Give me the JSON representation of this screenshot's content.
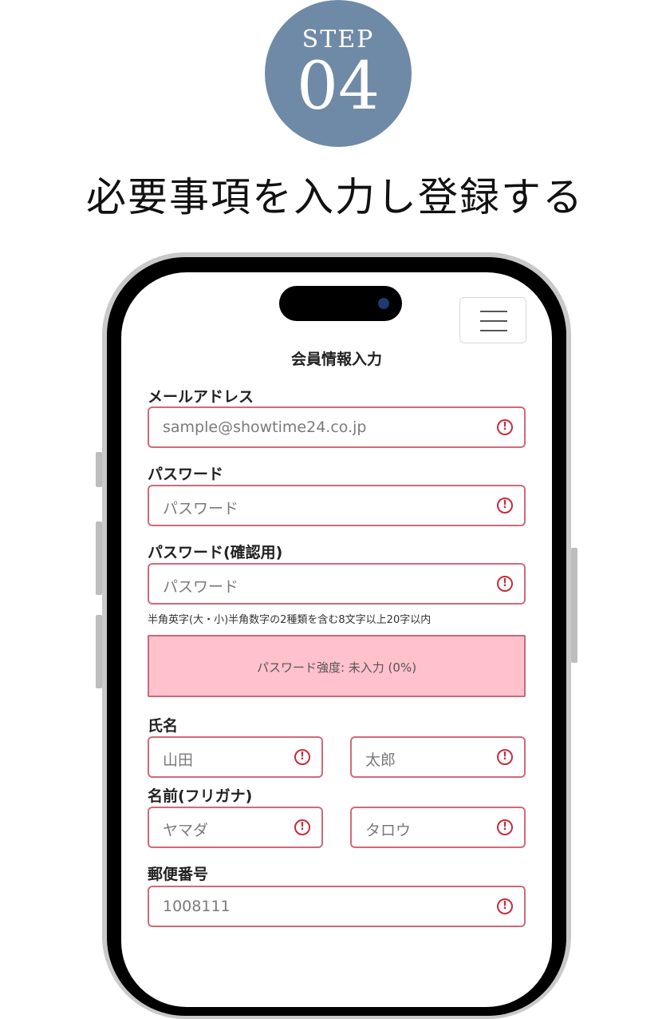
{
  "step": {
    "label": "STEP",
    "number": "04"
  },
  "headline": "必要事項を入力し登録する",
  "form": {
    "title": "会員情報入力",
    "email": {
      "label": "メールアドレス",
      "placeholder": "sample@showtime24.co.jp"
    },
    "password": {
      "label": "パスワード",
      "placeholder": "パスワード"
    },
    "password_confirm": {
      "label": "パスワード(確認用)",
      "placeholder": "パスワード"
    },
    "password_hint": "半角英字(大・小)半角数字の2種類を含む8文字以上20字以内",
    "strength": "パスワード強度: 未入力 (0%)",
    "name": {
      "label": "氏名",
      "last_placeholder": "山田",
      "first_placeholder": "太郎"
    },
    "kana": {
      "label": "名前(フリガナ)",
      "last_placeholder": "ヤマダ",
      "first_placeholder": "タロウ"
    },
    "postal": {
      "label": "郵便番号",
      "placeholder": "1008111"
    },
    "error_icon": "!"
  },
  "icons": {
    "menu": "hamburger-icon",
    "error": "alert-circle-icon"
  },
  "colors": {
    "step_circle": "#6f8aa6",
    "field_border": "#cf6a78",
    "error": "#c62d3d",
    "strength_bg": "#ffc1cb"
  }
}
